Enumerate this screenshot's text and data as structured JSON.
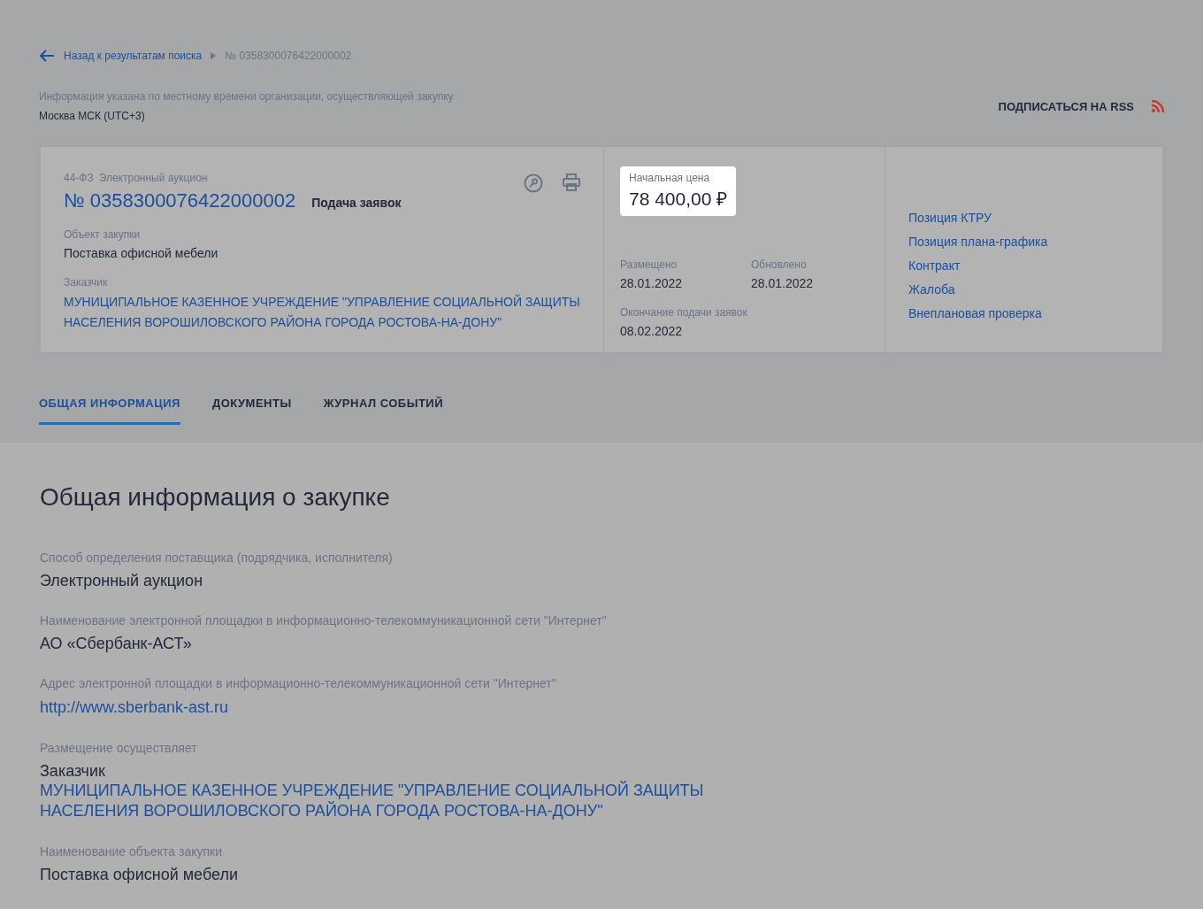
{
  "breadcrumb": {
    "back_link": "Назад к результатам поиска",
    "current": "№ 0358300076422000002"
  },
  "timezone": {
    "note": "Информация указана по местному времени организации, осуществляющей закупку",
    "value": "Москва МСК (UTC+3)"
  },
  "rss_link": "ПОДПИСАТЬСЯ НА RSS",
  "card": {
    "law": "44-ФЗ",
    "method": "Электронный аукцион",
    "number": "№ 0358300076422000002",
    "stage": "Подача заявок",
    "fields": [
      {
        "label": "Объект закупки",
        "value": "Поставка офисной мебели",
        "kind": "text"
      },
      {
        "label": "Заказчик",
        "value": "МУНИЦИПАЛЬНОЕ КАЗЕННОЕ УЧРЕЖДЕНИЕ \"УПРАВЛЕНИЕ СОЦИАЛЬНОЙ ЗАЩИТЫ НАСЕЛЕНИЯ ВОРОШИЛОВСКОГО РАЙОНА ГОРОДА РОСТОВА-НА-ДОНУ\"",
        "kind": "link"
      }
    ],
    "price": {
      "label": "Начальная цена",
      "value": "78 400,00 ₽"
    },
    "dates": [
      {
        "label": "Размещено",
        "value": "28.01.2022"
      },
      {
        "label": "Обновлено",
        "value": "28.01.2022"
      },
      {
        "label": "Окончание подачи заявок",
        "value": "08.02.2022"
      }
    ],
    "links": [
      "Позиция КТРУ",
      "Позиция плана-графика",
      "Контракт",
      "Жалоба",
      "Внеплановая проверка"
    ]
  },
  "tabs": [
    {
      "label": "ОБЩАЯ ИНФОРМАЦИЯ",
      "selected": true
    },
    {
      "label": "ДОКУМЕНТЫ",
      "selected": false
    },
    {
      "label": "ЖУРНАЛ СОБЫТИЙ",
      "selected": false
    }
  ],
  "section": {
    "title": "Общая информация о закупке",
    "fields": [
      {
        "label": "Способ определения поставщика (подрядчика, исполнителя)",
        "kind": "text",
        "lines": [
          "Электронный аукцион"
        ]
      },
      {
        "label": "Наименование электронной площадки в информационно-телекоммуникационной сети \"Интернет\"",
        "kind": "text",
        "lines": [
          "АО «Сбербанк-АСТ»"
        ]
      },
      {
        "label": "Адрес электронной площадки в информационно-телекоммуникационной сети \"Интернет\"",
        "kind": "link",
        "lines": [
          "http://www.sberbank-ast.ru"
        ]
      },
      {
        "label": "Размещение осуществляет",
        "kind": "text_link",
        "lines": [
          "Заказчик",
          "МУНИЦИПАЛЬНОЕ КАЗЕННОЕ УЧРЕЖДЕНИЕ \"УПРАВЛЕНИЕ СОЦИАЛЬНОЙ ЗАЩИТЫ НАСЕЛЕНИЯ ВОРОШИЛОВСКОГО РАЙОНА ГОРОДА РОСТОВА-НА-ДОНУ\""
        ]
      },
      {
        "label": "Наименование объекта закупки",
        "kind": "text",
        "lines": [
          "Поставка офисной мебели"
        ]
      }
    ]
  }
}
